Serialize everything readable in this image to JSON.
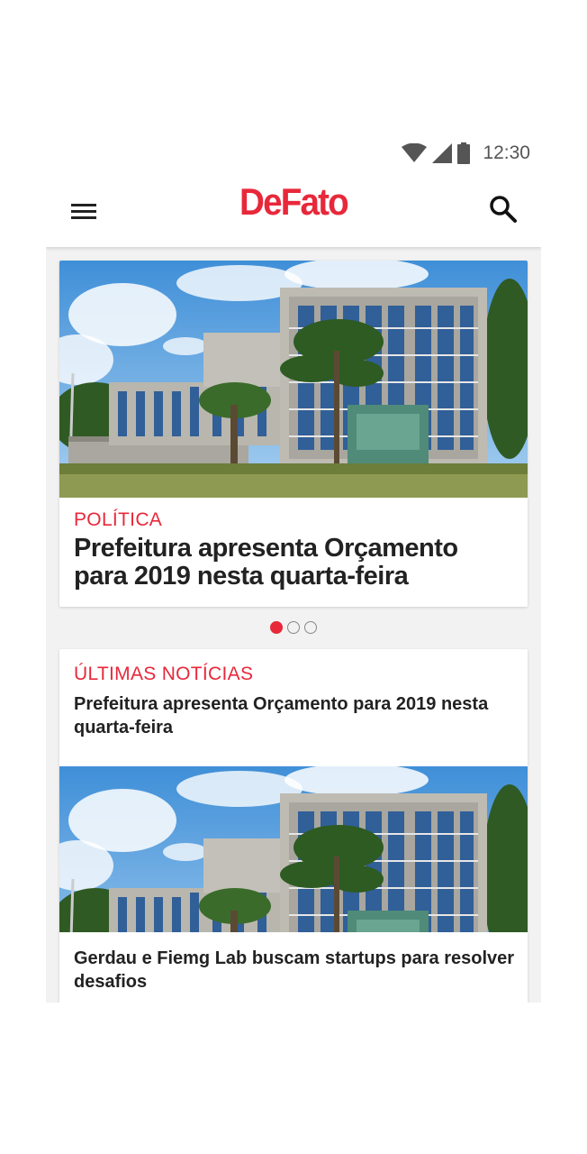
{
  "status_bar": {
    "time": "12:30",
    "icons": [
      "wifi-icon",
      "cellular-signal-icon",
      "battery-icon"
    ]
  },
  "app_bar": {
    "logo_text": "DeFato",
    "menu_icon": "hamburger-menu-icon",
    "search_icon": "search-icon"
  },
  "hero": {
    "category": "POLÍTICA",
    "title": "Prefeitura apresenta Orçamento para 2019 nesta quarta-feira",
    "image": "building-photo"
  },
  "carousel": {
    "active_index": 0,
    "count": 3
  },
  "latest": {
    "section_title": "ÚLTIMAS NOTÍCIAS",
    "items": [
      {
        "title": "Prefeitura apresenta Orçamento para 2019 nesta quarta-feira"
      },
      {
        "title": "Gerdau e Fiemg Lab buscam startups para resolver desafios"
      }
    ]
  },
  "colors": {
    "brand_red": "#e8283a",
    "text_dark": "#222222",
    "background": "#f2f2f2"
  }
}
